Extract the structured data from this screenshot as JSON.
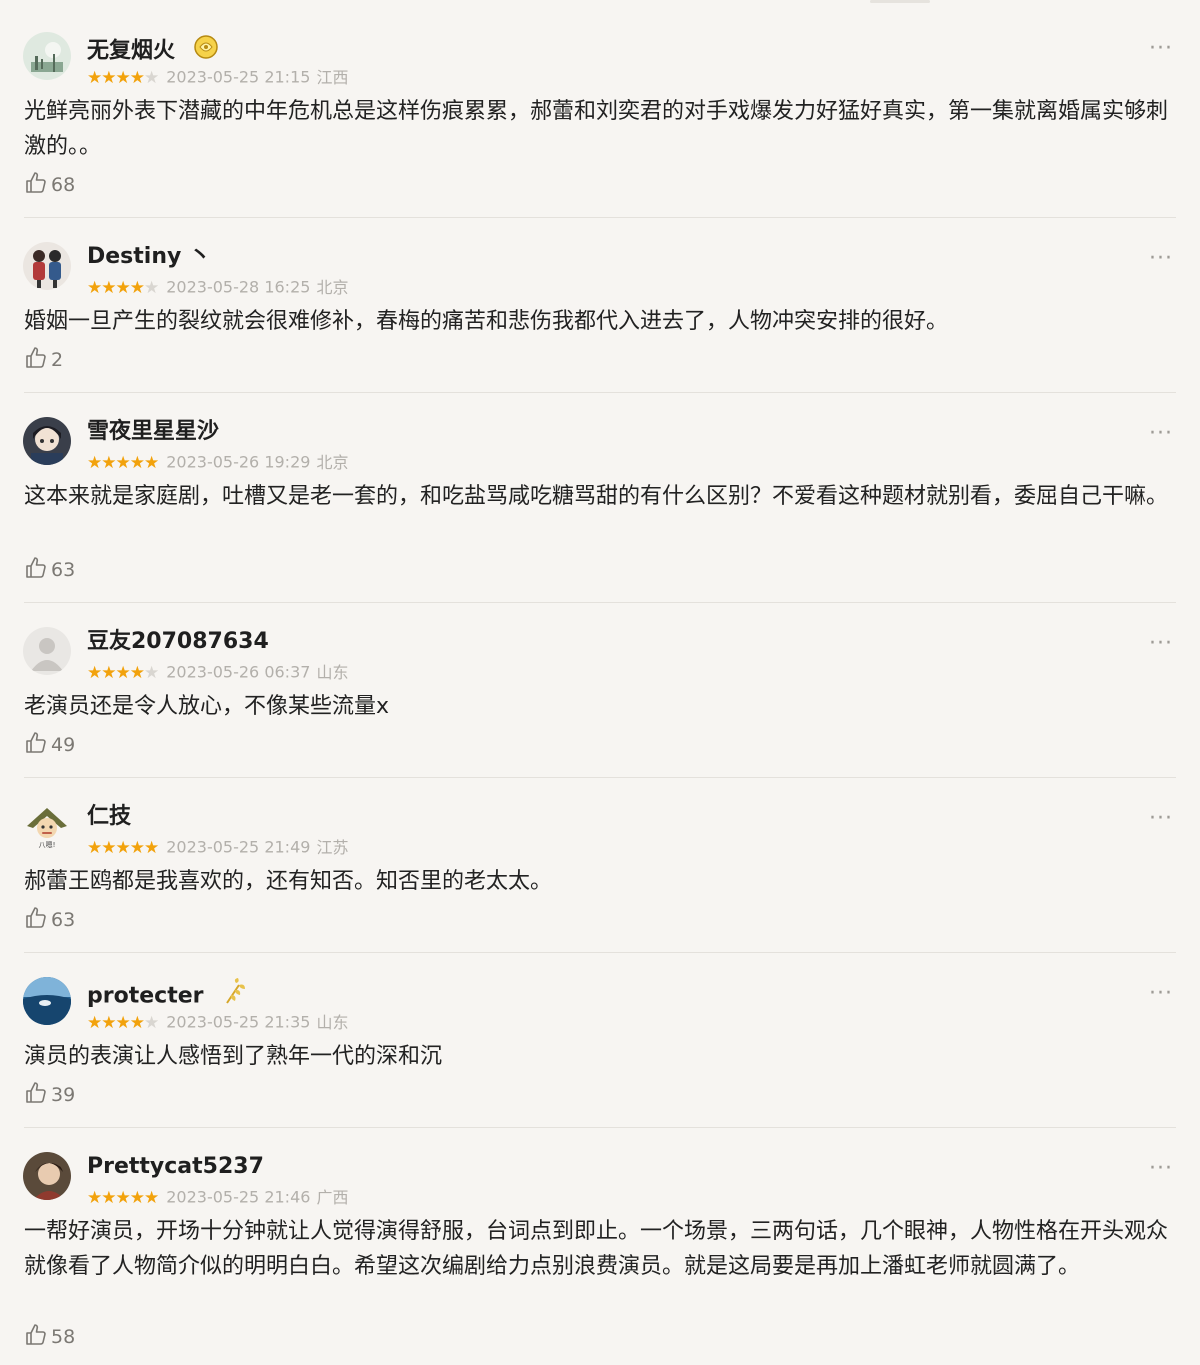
{
  "reviews": [
    {
      "user": "无复烟火",
      "stars": 4,
      "time": "2023-05-25 21:15",
      "location": "江西",
      "content": "光鲜亮丽外表下潜藏的中年危机总是这样伤痕累累，郝蕾和刘奕君的对手戏爆发力好猛好真实，第一集就离婚属实够刺激的。。",
      "likes": "68"
    },
    {
      "user": "Destiny 丶",
      "stars": 4,
      "time": "2023-05-28 16:25",
      "location": "北京",
      "content": "婚姻一旦产生的裂纹就会很难修补，春梅的痛苦和悲伤我都代入进去了，人物冲突安排的很好。",
      "likes": "2"
    },
    {
      "user": "雪夜里星星沙",
      "stars": 5,
      "time": "2023-05-26 19:29",
      "location": "北京",
      "content": "这本来就是家庭剧，吐槽又是老一套的，和吃盐骂咸吃糖骂甜的有什么区别？不爱看这种题材就别看，委屈自己干嘛。",
      "likes": "63"
    },
    {
      "user": "豆友207087634",
      "stars": 4,
      "time": "2023-05-26 06:37",
      "location": "山东",
      "content": "老演员还是令人放心，不像某些流量x",
      "likes": "49"
    },
    {
      "user": "仁技",
      "stars": 5,
      "time": "2023-05-25 21:49",
      "location": "江苏",
      "content": "郝蕾王鸥都是我喜欢的，还有知否。知否里的老太太。",
      "likes": "63"
    },
    {
      "user": "protecter",
      "stars": 4,
      "time": "2023-05-25 21:35",
      "location": "山东",
      "content": "演员的表演让人感悟到了熟年一代的深和沉",
      "likes": "39"
    },
    {
      "user": "Prettycat5237",
      "stars": 5,
      "time": "2023-05-25 21:46",
      "location": "广西",
      "content": "一帮好演员，开场十分钟就让人觉得演得舒服，台词点到即止。一个场景，三两句话，几个眼神，人物性格在开头观众就像看了人物简介似的明明白白。希望这次编剧给力点别浪费演员。就是这局要是再加上潘虹老师就圆满了。",
      "likes": "58"
    }
  ],
  "more_glyph": "···",
  "avatar_caption": "八嗯!",
  "colors": {
    "star": "#f2a20c",
    "star_off": "#d9d6d1",
    "meta": "#b3b0ab",
    "background": "#f7f5f2"
  }
}
